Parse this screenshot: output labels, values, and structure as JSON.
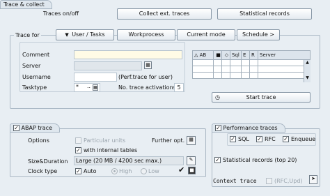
{
  "window": {
    "title": "Trace & collect"
  },
  "top": {
    "traces_label": "Traces on/off",
    "collect_btn": "Collect ext. traces",
    "stat_btn": "Statistical records"
  },
  "trace_for": {
    "label": "Trace for",
    "tabs": [
      "User / Tasks",
      "Workprocess",
      "Current mode",
      "Schedule >"
    ],
    "comment_label": "Comment",
    "server_label": "Server",
    "username_label": "Username",
    "perf_note": "(Perf.trace for user)",
    "tasktype_label": "Tasktype",
    "tasktype_value": "*",
    "tasktype_extra": "..",
    "activations_label": "No. trace activations",
    "activations_value": "5",
    "grid_headers": [
      "AB",
      "",
      "",
      "Sql",
      "E",
      "R",
      "Server"
    ],
    "start_btn": "Start trace"
  },
  "abap": {
    "title": "ABAP trace",
    "checked": true,
    "options_label": "Options",
    "particular_units": "Particular units",
    "further_opt": "Further opt.",
    "internal_tables": "with internal tables",
    "size_label": "Size&Duration",
    "size_value": "Large (20 MB / 4200 sec max.)",
    "clock_label": "Clock type",
    "auto": "Auto",
    "high": "High",
    "low": "Low"
  },
  "perf": {
    "title": "Performance traces",
    "sql": "SQL",
    "rfc": "RFC",
    "enqueue": "Enqueue",
    "stat_records": "Statistical records (top 20)",
    "context_label": "Context trace",
    "rfc_upd": "(RFC,Upd)"
  }
}
